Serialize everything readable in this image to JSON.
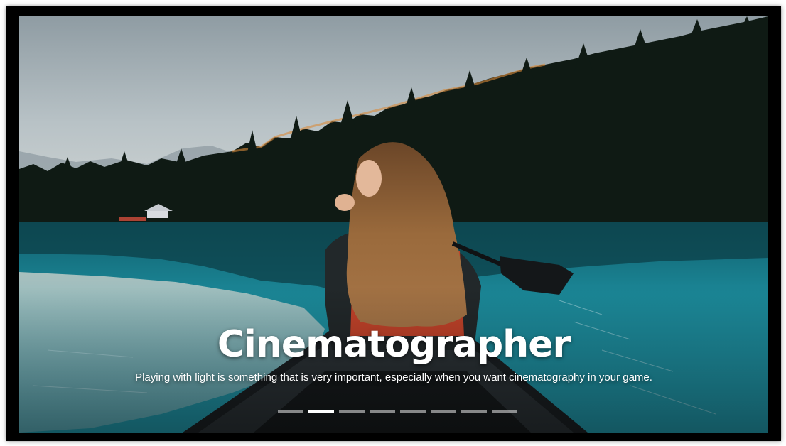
{
  "carousel": {
    "slide": {
      "title": "Cinematographer",
      "subtitle": "Playing with light is something that is very important, especially when you want cinematography in your game."
    },
    "indicators": [
      {
        "active": false
      },
      {
        "active": true
      },
      {
        "active": false
      },
      {
        "active": false
      },
      {
        "active": false
      },
      {
        "active": false
      },
      {
        "active": false
      },
      {
        "active": false
      }
    ]
  },
  "colors": {
    "frame": "#000000",
    "water": "#1f8fa3",
    "sky": "#c3ccd0",
    "forest": "#0e1812",
    "jacket": "#c3432a",
    "indicator_active": "#ffffff",
    "indicator_inactive": "#9aa5a8"
  }
}
